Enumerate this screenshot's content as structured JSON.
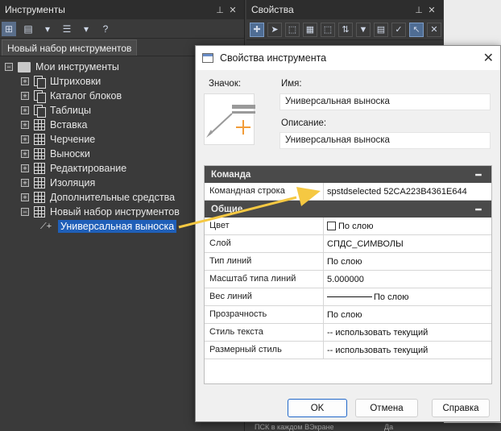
{
  "left_panel": {
    "title": "Инструменты",
    "tab": "Новый набор инструментов",
    "tree": {
      "root": "Мои инструменты",
      "items": [
        "Штриховки",
        "Каталог блоков",
        "Таблицы",
        "Вставка",
        "Черчение",
        "Выноски",
        "Редактирование",
        "Изоляция",
        "Дополнительные средства",
        "Новый набор инструментов"
      ],
      "child": "Универсальная выноска"
    }
  },
  "right_panel": {
    "title": "Свойства"
  },
  "dialog": {
    "title": "Свойства инструмента",
    "icon_label": "Значок:",
    "name_label": "Имя:",
    "name_value": "Универсальная выноска",
    "desc_label": "Описание:",
    "desc_value": "Универсальная выноска",
    "sections": {
      "command": {
        "title": "Команда",
        "rows": [
          {
            "key": "Командная строка",
            "value": "spstdselected 52CA223B4361E644"
          }
        ]
      },
      "general": {
        "title": "Общие",
        "rows": [
          {
            "key": "Цвет",
            "value": "По слою"
          },
          {
            "key": "Слой",
            "value": "СПДС_СИМВОЛЫ"
          },
          {
            "key": "Тип линий",
            "value": "По слою"
          },
          {
            "key": "Масштаб типа линий",
            "value": "5.000000"
          },
          {
            "key": "Вес линий",
            "value": "По слою"
          },
          {
            "key": "Прозрачность",
            "value": "По слою"
          },
          {
            "key": "Стиль текста",
            "value": "-- использовать текущий"
          },
          {
            "key": "Размерный стиль",
            "value": "-- использовать текущий"
          }
        ]
      }
    },
    "collapse_glyph": "━",
    "buttons": {
      "ok": "OK",
      "cancel": "Отмена",
      "help": "Справка"
    }
  },
  "bottom_text": "ПСК в каждом ВЭкране",
  "bottom_suffix": "Да",
  "colors": {
    "arrow": "#f5c842",
    "selection": "#1f5fb8",
    "dark_bg": "#3a3a3a",
    "category": "#4a4a4a"
  }
}
